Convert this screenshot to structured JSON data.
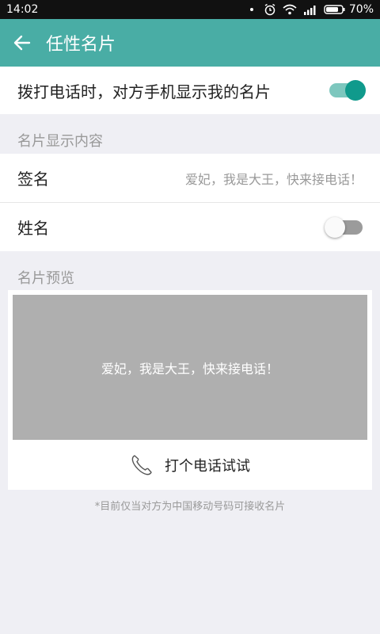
{
  "status_bar": {
    "time": "14:02",
    "battery_percent": "70%",
    "icons": [
      "alarm-icon",
      "wifi-icon",
      "signal-icon",
      "battery-icon"
    ]
  },
  "app_bar": {
    "back_icon": "arrow-left-icon",
    "title": "任性名片",
    "color": "#49ada5"
  },
  "dial_setting": {
    "label": "拨打电话时，对方手机显示我的名片",
    "enabled": true
  },
  "content_section": {
    "header": "名片显示内容",
    "signature": {
      "label": "签名",
      "value": "爱妃，我是大王，快来接电话！"
    },
    "name": {
      "label": "姓名",
      "enabled": false
    }
  },
  "preview_section": {
    "header": "名片预览",
    "preview_text": "爱妃，我是大王，快来接电话！",
    "call_button_icon": "phone-icon",
    "call_button_label": "打个电话试试"
  },
  "footnote": "*目前仅当对方为中国移动号码可接收名片"
}
